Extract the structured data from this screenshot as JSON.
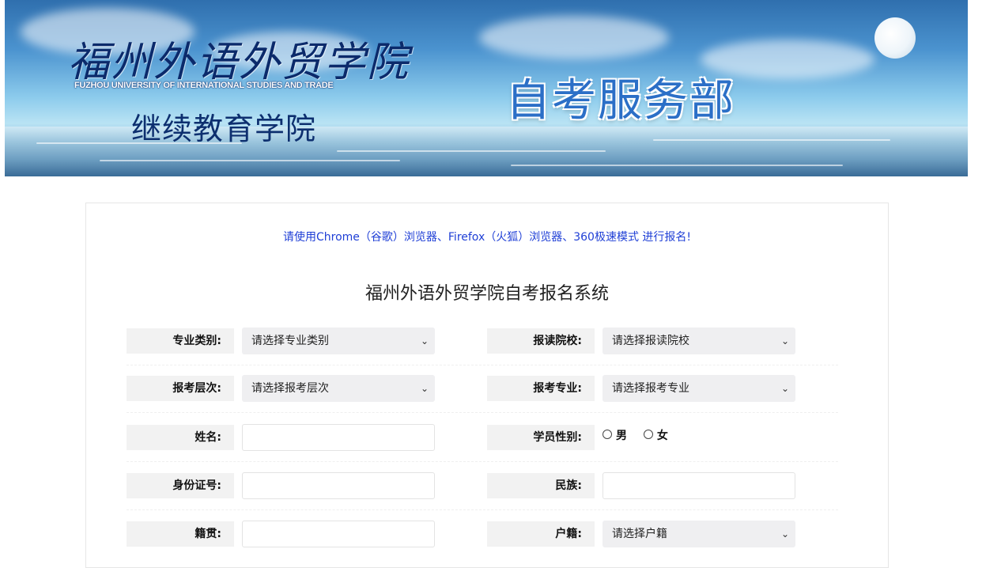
{
  "banner": {
    "school_script": "福州外语外贸学院",
    "school_en": "FUZHOU UNIVERSITY OF INTERNATIONAL STUDIES AND TRADE",
    "college": "继续教育学院",
    "department": "自考服务部"
  },
  "notice": "请使用Chrome（谷歌）浏览器、Firefox（火狐）浏览器、360极速模式 进行报名!",
  "form_title": "福州外语外贸学院自考报名系统",
  "fields": {
    "major_category": {
      "label": "专业类别:",
      "value": "请选择专业类别"
    },
    "school": {
      "label": "报读院校:",
      "value": "请选择报读院校"
    },
    "level": {
      "label": "报考层次:",
      "value": "请选择报考层次"
    },
    "major": {
      "label": "报考专业:",
      "value": "请选择报考专业"
    },
    "name": {
      "label": "姓名:",
      "value": ""
    },
    "gender": {
      "label": "学员性别:",
      "options": [
        "男",
        "女"
      ]
    },
    "id_number": {
      "label": "身份证号:",
      "value": ""
    },
    "ethnicity": {
      "label": "民族:",
      "value": ""
    },
    "native_place": {
      "label": "籍贯:",
      "value": ""
    },
    "household": {
      "label": "户籍:",
      "value": "请选择户籍"
    }
  },
  "colors": {
    "notice": "#1f3fd6",
    "banner_title": "#2b6fc7",
    "label_bg": "#f2f2f2",
    "select_bg": "#efeff1"
  },
  "icons": {
    "dropdown": "chevron-down-icon",
    "radio": "radio-circle-icon"
  }
}
